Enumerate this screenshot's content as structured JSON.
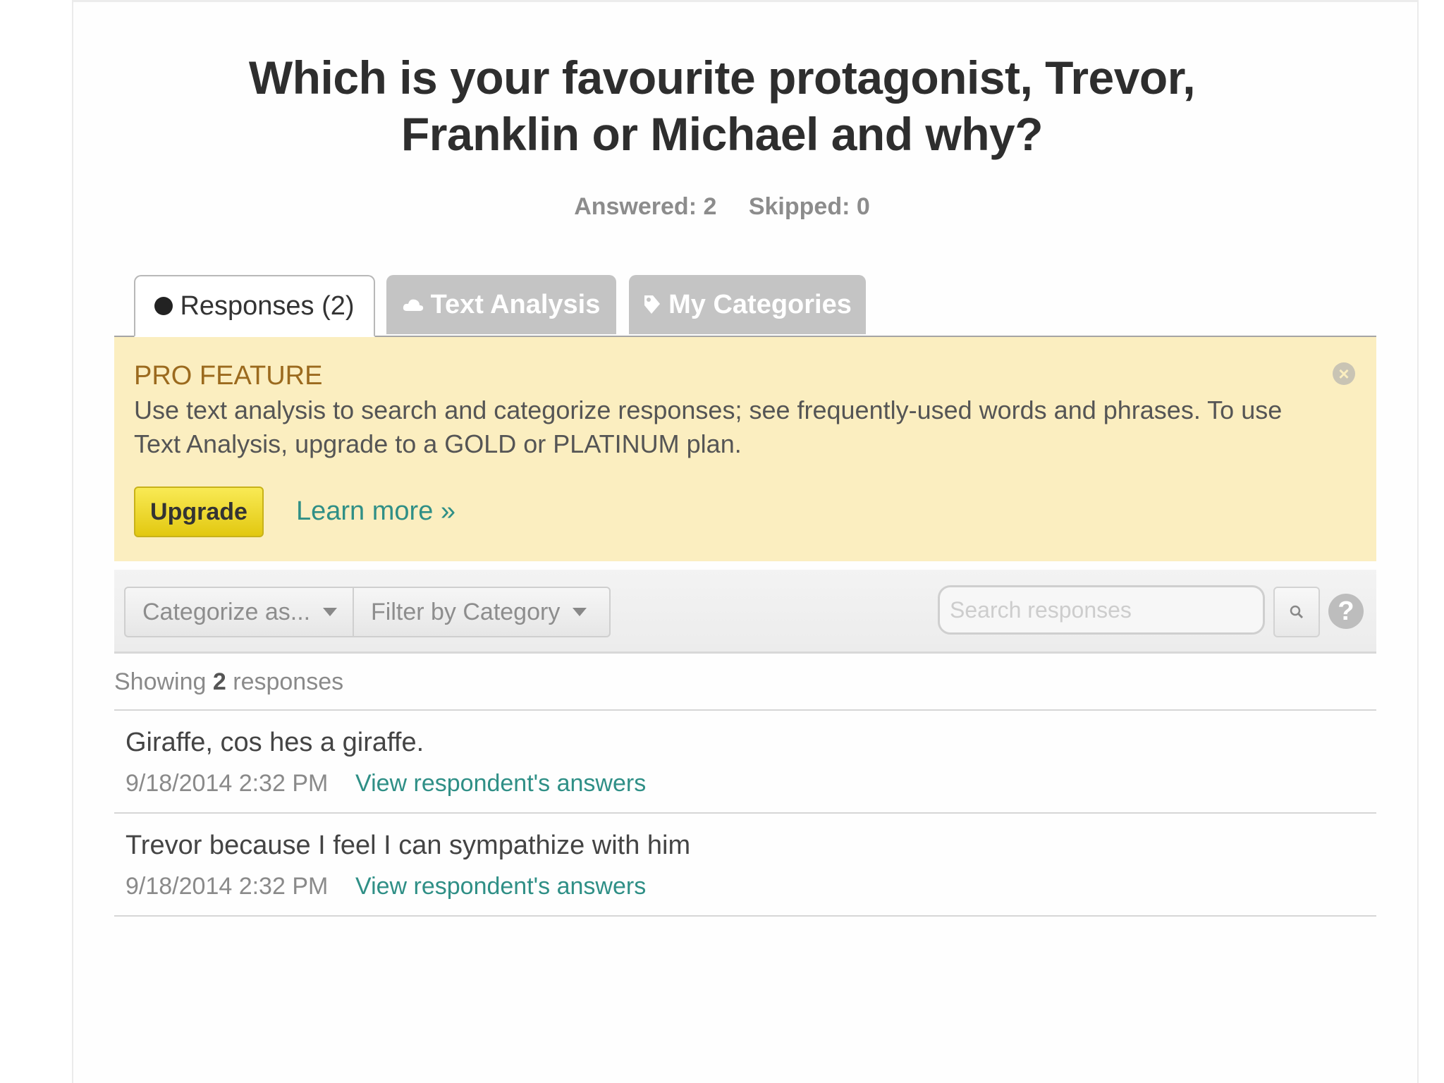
{
  "question": {
    "title_line1": "Which is your favourite protagonist, Trevor,",
    "title_line2": "Franklin or Michael and why?"
  },
  "stats": {
    "answered": "Answered: 2",
    "skipped": "Skipped: 0"
  },
  "tabs": [
    {
      "label": "Responses (2)",
      "active": true,
      "icon": "bullet-icon"
    },
    {
      "label": "Text Analysis",
      "active": false,
      "icon": "cloud-icon"
    },
    {
      "label": "My Categories",
      "active": false,
      "icon": "tag-icon"
    }
  ],
  "pro_feature": {
    "title": "PRO FEATURE",
    "text": "Use text analysis to search and categorize responses; see frequently-used words and phrases. To use Text Analysis, upgrade to a GOLD or PLATINUM plan.",
    "upgrade_label": "Upgrade",
    "learn_more_label": "Learn more »",
    "close_icon": "close-icon"
  },
  "toolbar": {
    "categorize_label": "Categorize as...",
    "filter_label": "Filter by Category",
    "search_placeholder": "Search responses",
    "help_label": "?"
  },
  "showing": {
    "prefix": "Showing",
    "count": "2",
    "suffix": "responses"
  },
  "responses": [
    {
      "text": "Giraffe, cos hes a giraffe.",
      "date": "9/18/2014 2:32 PM",
      "link": "View respondent's answers"
    },
    {
      "text": "Trevor because I feel I can sympathize with him",
      "date": "9/18/2014 2:32 PM",
      "link": "View respondent's answers"
    }
  ],
  "colors": {
    "accent_link": "#2f8f86",
    "pro_background": "#fbeec0",
    "upgrade_button": "#f0d630"
  }
}
